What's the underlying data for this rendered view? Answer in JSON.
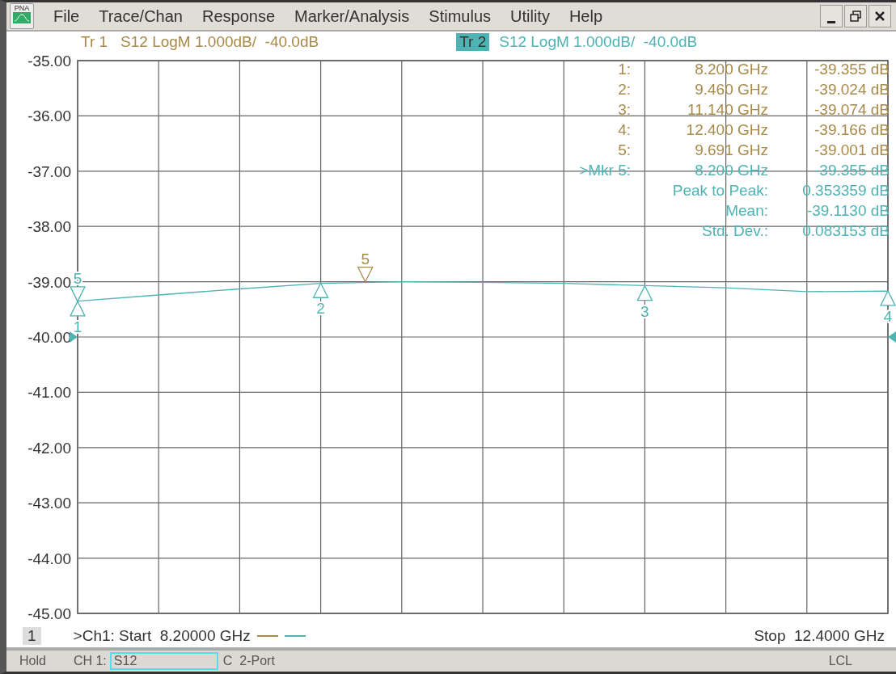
{
  "window": {
    "app_icon_label": "PNA",
    "menu": [
      "File",
      "Trace/Chan",
      "Response",
      "Marker/Analysis",
      "Stimulus",
      "Utility",
      "Help"
    ]
  },
  "traces": [
    {
      "label": "Tr 1",
      "text": "S12 LogM 1.000dB/  -40.0dB",
      "color": "#a88a4a",
      "selected": false
    },
    {
      "label": "Tr 2",
      "text": "S12 LogM 1.000dB/  -40.0dB",
      "color": "#4fb3b3",
      "selected": true
    }
  ],
  "marker_readout": [
    {
      "kind": "marker",
      "color": "#a88a4a",
      "label": "1:",
      "frequency": "8.200 GHz",
      "value": "-39.355 dB"
    },
    {
      "kind": "marker",
      "color": "#a88a4a",
      "label": "2:",
      "frequency": "9.460 GHz",
      "value": "-39.024 dB"
    },
    {
      "kind": "marker",
      "color": "#a88a4a",
      "label": "3:",
      "frequency": "11.140 GHz",
      "value": "-39.074 dB"
    },
    {
      "kind": "marker",
      "color": "#a88a4a",
      "label": "4:",
      "frequency": "12.400 GHz",
      "value": "-39.166 dB"
    },
    {
      "kind": "marker",
      "color": "#a88a4a",
      "label": "5:",
      "frequency": "9.691 GHz",
      "value": "-39.001 dB"
    },
    {
      "kind": "marker",
      "color": "#4fb3b3",
      "label": ">Mkr 5:",
      "frequency": "8.200 GHz",
      "value": "-39.355 dB"
    },
    {
      "kind": "statistic",
      "color": "#4fb3b3",
      "label": "Peak to Peak:",
      "value": "0.353359 dB"
    },
    {
      "kind": "statistic",
      "color": "#4fb3b3",
      "label": "Mean:",
      "value": "-39.1130 dB"
    },
    {
      "kind": "statistic",
      "color": "#4fb3b3",
      "label": "Std. Dev.:",
      "value": "0.083153 dB"
    }
  ],
  "markers": [
    {
      "text": "1",
      "kind": "up",
      "color": "#4fb3b3"
    },
    {
      "text": "5",
      "kind": "down",
      "color": "#4fb3b3"
    },
    {
      "text": "2",
      "kind": "up",
      "color": "#4fb3b3"
    },
    {
      "text": "3",
      "kind": "up",
      "color": "#4fb3b3"
    },
    {
      "text": "4",
      "kind": "up",
      "color": "#4fb3b3"
    },
    {
      "text": "5",
      "kind": "down",
      "color": "#a88a4a"
    }
  ],
  "chart_data": {
    "type": "line",
    "ylim": [
      -45,
      -35
    ],
    "grid": true,
    "categories": [
      null,
      null,
      null,
      null,
      null,
      null,
      null,
      null,
      null,
      null,
      null
    ],
    "series": [
      {
        "color": "#4fb3b3",
        "values": [
          -39.35,
          -39.24,
          -39.13,
          -39.03,
          -39.0,
          -39.01,
          -39.03,
          -39.07,
          -39.11,
          -39.18,
          -39.17
        ]
      }
    ],
    "yticks": [
      {
        "value": -35,
        "label": "-35.00"
      },
      {
        "value": -36,
        "label": "-36.00"
      },
      {
        "value": -37,
        "label": "-37.00"
      },
      {
        "value": -38,
        "label": "-38.00"
      },
      {
        "value": -39,
        "label": "-39.00"
      },
      {
        "value": -40,
        "label": "-40.00"
      },
      {
        "value": -41,
        "label": "-41.00"
      },
      {
        "value": -42,
        "label": "-42.00"
      },
      {
        "value": -43,
        "label": "-43.00"
      },
      {
        "value": -44,
        "label": "-44.00"
      },
      {
        "value": -45,
        "label": "-45.00"
      }
    ]
  },
  "footer": {
    "channel": "1",
    "start": ">Ch1: Start  8.20000 GHz",
    "stop": "Stop  12.4000 GHz"
  },
  "status_bar": {
    "mode": "Hold",
    "channel_label": "CH 1:",
    "parameter": "S12",
    "calibration": "C  2-Port",
    "remote": "LCL"
  }
}
